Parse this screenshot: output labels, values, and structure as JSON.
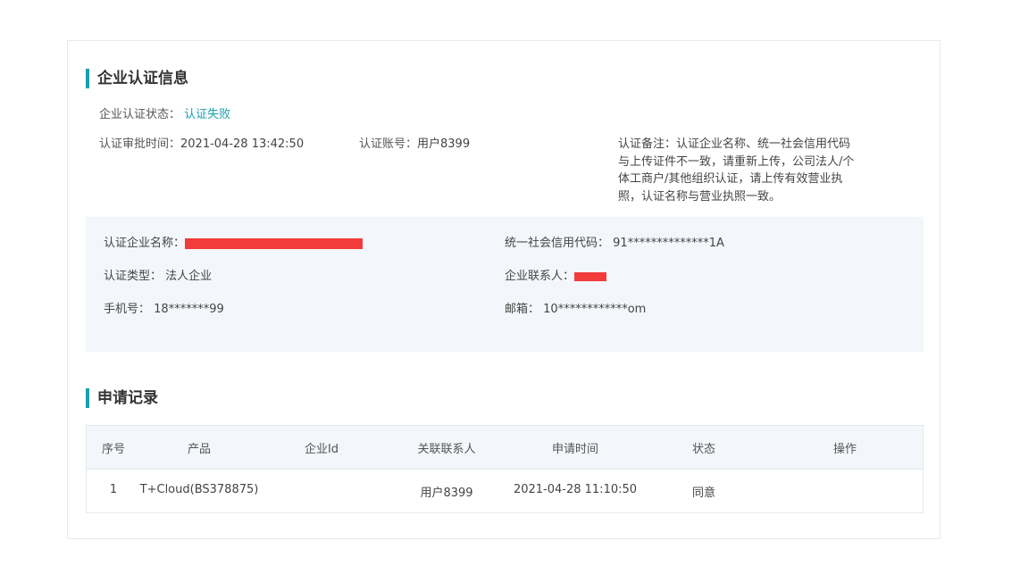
{
  "section1": {
    "title": "企业认证信息",
    "status_label": "企业认证状态：",
    "status_value": "认证失败",
    "approval_time_label": "认证审批时间：",
    "approval_time_value": "2021-04-28 13:42:50",
    "account_label": "认证账号：",
    "account_value": "用户8399",
    "remark_label": "认证备注：",
    "remark_value": "认证企业名称、统一社会信用代码与上传证件不一致，请重新上传，公司法人/个体工商户/其他组织认证，请上传有效营业执照，认证名称与营业执照一致。"
  },
  "info": {
    "company_name_label": "认证企业名称：",
    "credit_code_label": "统一社会信用代码：",
    "credit_code_value": "91**************1A",
    "type_label": "认证类型：",
    "type_value": "法人企业",
    "contact_label": "企业联系人：",
    "phone_label": "手机号：",
    "phone_value": "18*******99",
    "email_label": "邮箱：",
    "email_value": "10************om",
    "redaction_color": "#f23b3b"
  },
  "section2": {
    "title": "申请记录",
    "columns": [
      "序号",
      "产品",
      "企业Id",
      "关联联系人",
      "申请时间",
      "状态",
      "操作"
    ],
    "rows": [
      [
        "1",
        "T+Cloud(BS378875)",
        "",
        "用户8399",
        "2021-04-28 11:10:50",
        "同意",
        ""
      ]
    ]
  },
  "colors": {
    "accent": "#1a9fb2",
    "panel_bg": "#f3f6fa"
  }
}
